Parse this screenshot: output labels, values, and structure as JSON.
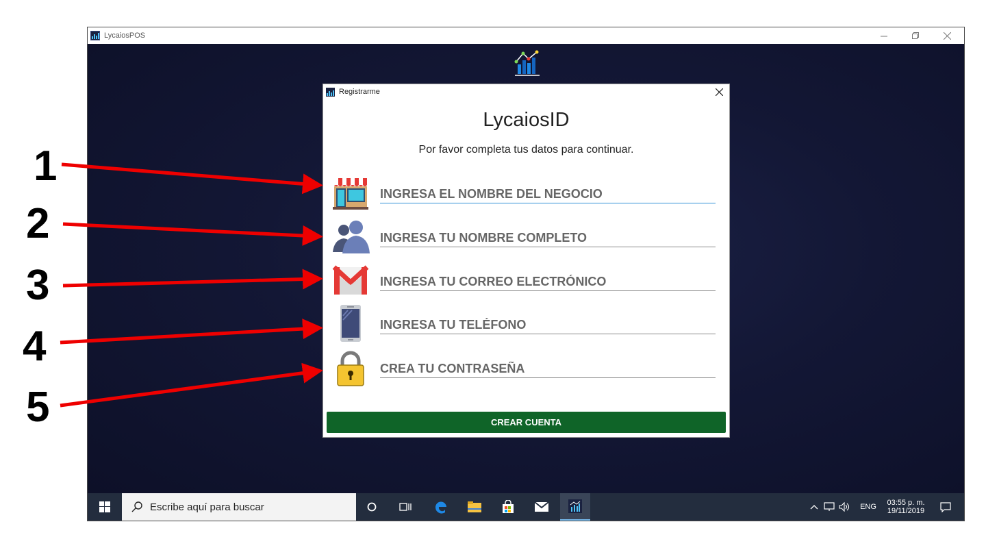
{
  "window": {
    "title": "LycaiosPOS",
    "controls": [
      "minimize-icon",
      "restore-icon",
      "close-icon"
    ]
  },
  "dialog": {
    "title": "Registrarme",
    "heading": "LycaiosID",
    "subheading": "Por favor completa tus datos para continuar.",
    "fields": [
      {
        "icon": "store-icon",
        "placeholder": "INGRESA EL NOMBRE DEL NEGOCIO",
        "value": ""
      },
      {
        "icon": "users-icon",
        "placeholder": "INGRESA TU NOMBRE COMPLETO",
        "value": ""
      },
      {
        "icon": "gmail-icon",
        "placeholder": "INGRESA TU CORREO ELECTRÓNICO",
        "value": ""
      },
      {
        "icon": "phone-icon",
        "placeholder": "INGRESA TU TELÉFONO",
        "value": ""
      },
      {
        "icon": "padlock-icon",
        "placeholder": "CREA TU CONTRASEÑA",
        "value": ""
      }
    ],
    "submit_label": "CREAR CUENTA",
    "colors": {
      "submit": "#0f6428",
      "active_underline": "#2e8fd6"
    }
  },
  "taskbar": {
    "search_placeholder": "Escribe aquí para buscar",
    "language": "ENG",
    "time": "03:55 p. m.",
    "date": "19/11/2019",
    "apps": [
      "cortana-icon",
      "task-view-icon",
      "edge-icon",
      "file-explorer-icon",
      "store-icon",
      "mail-icon",
      "lycaiospos-icon"
    ]
  },
  "annotations": [
    "1",
    "2",
    "3",
    "4",
    "5"
  ],
  "colors": {
    "desktop": "#131735",
    "taskbar": "#232d3e",
    "arrow": "#ee0000"
  }
}
